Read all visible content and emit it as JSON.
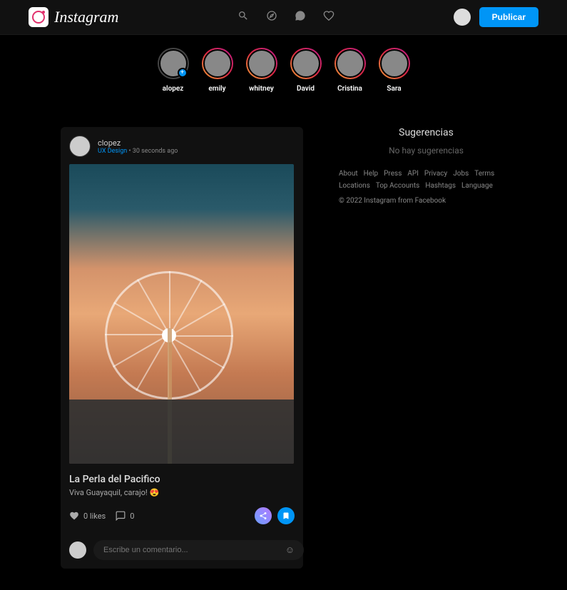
{
  "brand": "Instagram",
  "header": {
    "publish": "Publicar"
  },
  "stories": [
    {
      "name": "alopez",
      "own": true
    },
    {
      "name": "emily"
    },
    {
      "name": "whitney"
    },
    {
      "name": "David"
    },
    {
      "name": "Cristina"
    },
    {
      "name": "Sara"
    }
  ],
  "post": {
    "username": "clopez",
    "category": "UX Design",
    "time": "30 seconds ago",
    "separator": " • ",
    "title": "La Perla del Pacifico",
    "caption": "Viva Guayaquil, carajo! 😍",
    "likes": "0 likes",
    "comments": "0",
    "commentPlaceholder": "Escribe un comentario..."
  },
  "sidebar": {
    "title": "Sugerencias",
    "empty": "No hay sugerencias",
    "links": [
      "About",
      "Help",
      "Press",
      "API",
      "Privacy",
      "Jobs",
      "Terms",
      "Locations",
      "Top Accounts",
      "Hashtags",
      "Language"
    ],
    "copyright": "© 2022 Instagram from Facebook"
  }
}
